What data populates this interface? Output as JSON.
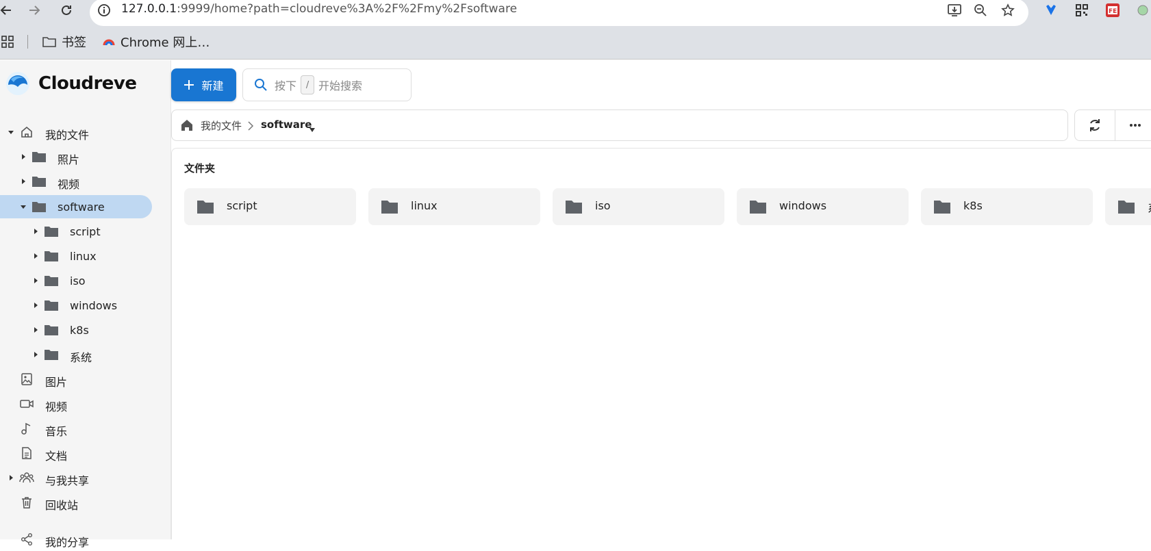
{
  "browser": {
    "url_host": "127.0.0.1",
    "url_rest": ":9999/home?path=cloudreve%3A%2F%2Fmy%2Fsoftware",
    "bookmarks": [
      {
        "label": "书签"
      },
      {
        "label": "Chrome 网上…"
      }
    ]
  },
  "app": {
    "name": "Cloudreve",
    "accent_color": "#1976d2",
    "new_button_label": "新建",
    "search": {
      "prefix": "按下",
      "key": "/",
      "suffix": "开始搜索"
    }
  },
  "sidebar": {
    "my_files": "我的文件",
    "tree": [
      {
        "label": "照片",
        "level": 1
      },
      {
        "label": "视频",
        "level": 1
      },
      {
        "label": "software",
        "level": 1,
        "selected": true,
        "expanded": true
      },
      {
        "label": "script",
        "level": 2
      },
      {
        "label": "linux",
        "level": 2
      },
      {
        "label": "iso",
        "level": 2
      },
      {
        "label": "windows",
        "level": 2
      },
      {
        "label": "k8s",
        "level": 2
      },
      {
        "label": "系统",
        "level": 2
      }
    ],
    "categories": [
      {
        "label": "图片",
        "icon": "image-icon"
      },
      {
        "label": "视频",
        "icon": "video-icon"
      },
      {
        "label": "音乐",
        "icon": "music-icon"
      },
      {
        "label": "文档",
        "icon": "document-icon"
      },
      {
        "label": "与我共享",
        "icon": "shared-with-me-icon"
      },
      {
        "label": "回收站",
        "icon": "trash-icon"
      },
      {
        "label": "我的分享",
        "icon": "share-icon"
      }
    ]
  },
  "breadcrumb": {
    "root": "我的文件",
    "current": "software"
  },
  "content": {
    "section_title": "文件夹",
    "folders": [
      "script",
      "linux",
      "iso",
      "windows",
      "k8s",
      "系统"
    ]
  }
}
